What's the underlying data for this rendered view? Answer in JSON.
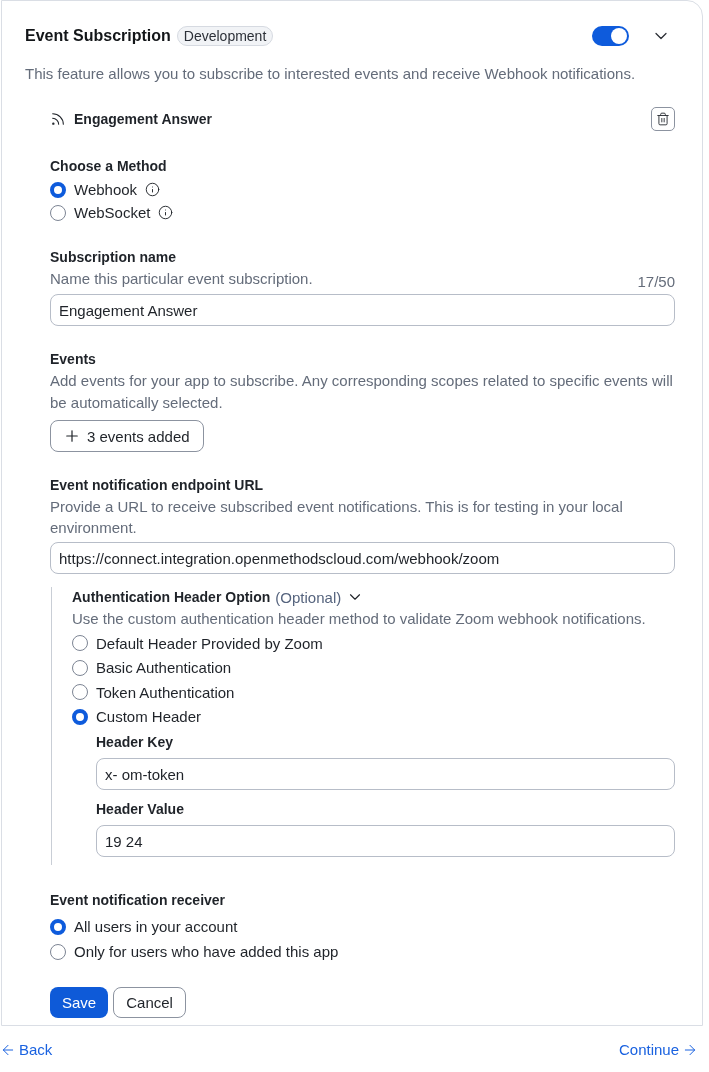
{
  "section": {
    "title": "Event Subscription",
    "badge": "Development",
    "enabled": true,
    "description": "This feature allows you to subscribe to interested events and receive Webhook notifications."
  },
  "subscription": {
    "title": "Engagement Answer"
  },
  "method": {
    "label": "Choose a Method",
    "options": [
      {
        "label": "Webhook",
        "selected": true
      },
      {
        "label": "WebSocket",
        "selected": false
      }
    ]
  },
  "subscription_name": {
    "label": "Subscription name",
    "hint": "Name this particular event subscription.",
    "counter": "17/50",
    "value": "Engagement Answer"
  },
  "events": {
    "label": "Events",
    "description": "Add events for your app to subscribe. Any corresponding scopes related to specific events will be automatically selected.",
    "button": "3 events added"
  },
  "endpoint": {
    "label": "Event notification endpoint URL",
    "description": "Provide a URL to receive subscribed event notifications. This is for testing in your local environment.",
    "value": "https://connect.integration.openmethodscloud.com/webhook/zoom"
  },
  "auth_header": {
    "title": "Authentication Header Option",
    "optional": "(Optional)",
    "description": "Use the custom authentication header method to validate Zoom webhook notifications.",
    "options": [
      {
        "label": "Default Header Provided by Zoom",
        "selected": false
      },
      {
        "label": "Basic Authentication",
        "selected": false
      },
      {
        "label": "Token Authentication",
        "selected": false
      },
      {
        "label": "Custom Header",
        "selected": true
      }
    ],
    "header_key": {
      "label": "Header Key",
      "value": "x- om-token"
    },
    "header_value": {
      "label": "Header Value",
      "value": "19 24"
    }
  },
  "receiver": {
    "label": "Event notification receiver",
    "options": [
      {
        "label": "All users in your account",
        "selected": true
      },
      {
        "label": "Only for users who have added this app",
        "selected": false
      }
    ]
  },
  "actions": {
    "save": "Save",
    "cancel": "Cancel"
  },
  "footer": {
    "back": "Back",
    "continue": "Continue"
  }
}
